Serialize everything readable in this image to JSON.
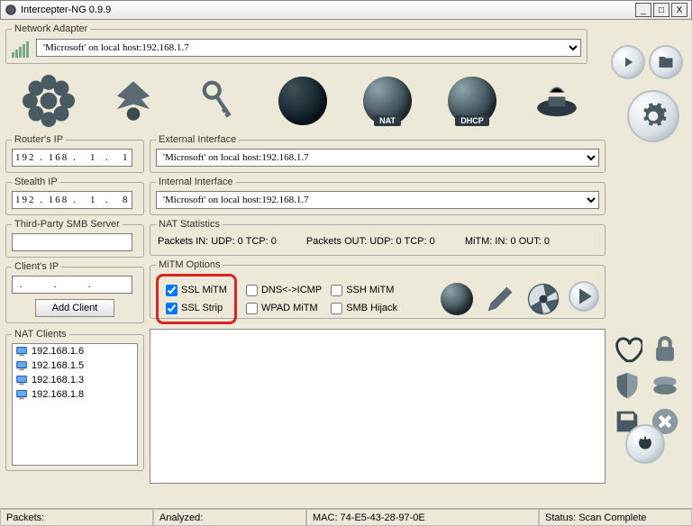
{
  "window": {
    "title": "Intercepter-NG 0.9.9"
  },
  "adapter": {
    "legend": "Network Adapter",
    "value": "'Microsoft' on local host:192.168.1.7"
  },
  "router_ip": {
    "legend": "Router's IP",
    "value": "192 . 168 .   1  .   1"
  },
  "stealth_ip": {
    "legend": "Stealth IP",
    "value": "192 . 168 .   1  .   8"
  },
  "smb": {
    "legend": "Third-Party SMB Server",
    "value": ""
  },
  "client_ip": {
    "legend": "Client's IP",
    "value": " .       .       .",
    "add_btn": "Add Client"
  },
  "ext_if": {
    "legend": "External Interface",
    "value": "'Microsoft' on local host:192.168.1.7"
  },
  "int_if": {
    "legend": "Internal Interface",
    "value": "'Microsoft' on local host:192.168.1.7"
  },
  "nat_stats": {
    "legend": "NAT Statistics",
    "in": "Packets IN: UDP: 0 TCP: 0",
    "out": "Packets OUT: UDP: 0 TCP: 0",
    "mitm": "MiTM: IN: 0 OUT: 0"
  },
  "mitm": {
    "legend": "MiTM Options",
    "ssl_mitm": "SSL MiTM",
    "ssl_strip": "SSL Strip",
    "dns_icmp": "DNS<->ICMP",
    "wpad": "WPAD MiTM",
    "ssh": "SSH MiTM",
    "smb": "SMB Hijack"
  },
  "clients": {
    "legend": "NAT Clients",
    "items": [
      "192.168.1.6",
      "192.168.1.5",
      "192.168.1.3",
      "192.168.1.8"
    ]
  },
  "toolbar_icons": {
    "nat": "NAT",
    "dhcp": "DHCP"
  },
  "status": {
    "packets": "Packets:",
    "analyzed": "Analyzed:",
    "mac": "MAC: 74-E5-43-28-97-0E",
    "state": "Status: Scan Complete"
  }
}
